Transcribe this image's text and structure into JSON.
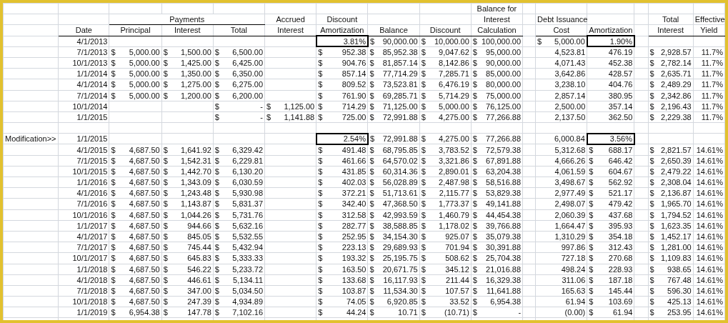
{
  "header_rows": [
    [
      null,
      null,
      null,
      null,
      null,
      null,
      null,
      null,
      null,
      "Balance for",
      null,
      null,
      null,
      null,
      null,
      null
    ],
    [
      null,
      null,
      {
        "kind": "group",
        "text": "Payments"
      },
      null,
      null,
      "Accrued",
      "Discount",
      null,
      null,
      "Interest",
      null,
      "Debt Issuance",
      null,
      null,
      "Total",
      "Effective"
    ],
    [
      null,
      "Date",
      "Principal",
      "Interest",
      "Total",
      "Interest",
      "Amortization",
      "Balance",
      "Discount",
      "Calculation",
      null,
      "Cost",
      "Amortization",
      null,
      "Interest",
      "Yield"
    ]
  ],
  "rows": [
    [
      null,
      "4/1/2013",
      null,
      null,
      null,
      null,
      {
        "kind": "boxed",
        "value": "3.81%"
      },
      [
        "$",
        "90,000.00"
      ],
      [
        "$",
        "10,000.00"
      ],
      [
        "$",
        "100,000.00"
      ],
      null,
      [
        "$",
        "5,000.00"
      ],
      {
        "kind": "boxed",
        "value": "1.90%"
      },
      null,
      null,
      null
    ],
    [
      null,
      "7/1/2013",
      [
        "$",
        "5,000.00"
      ],
      [
        "$",
        "1,500.00"
      ],
      [
        "$",
        "6,500.00"
      ],
      null,
      [
        "$",
        "952.38"
      ],
      [
        "$",
        "85,952.38"
      ],
      [
        "$",
        "9,047.62"
      ],
      [
        "$",
        "95,000.00"
      ],
      null,
      "4,523.81",
      "476.19",
      null,
      [
        "$",
        "2,928.57"
      ],
      "11.7%"
    ],
    [
      null,
      "10/1/2013",
      [
        "$",
        "5,000.00"
      ],
      [
        "$",
        "1,425.00"
      ],
      [
        "$",
        "6,425.00"
      ],
      null,
      [
        "$",
        "904.76"
      ],
      [
        "$",
        "81,857.14"
      ],
      [
        "$",
        "8,142.86"
      ],
      [
        "$",
        "90,000.00"
      ],
      null,
      "4,071.43",
      "452.38",
      null,
      [
        "$",
        "2,782.14"
      ],
      "11.7%"
    ],
    [
      null,
      "1/1/2014",
      [
        "$",
        "5,000.00"
      ],
      [
        "$",
        "1,350.00"
      ],
      [
        "$",
        "6,350.00"
      ],
      null,
      [
        "$",
        "857.14"
      ],
      [
        "$",
        "77,714.29"
      ],
      [
        "$",
        "7,285.71"
      ],
      [
        "$",
        "85,000.00"
      ],
      null,
      "3,642.86",
      "428.57",
      null,
      [
        "$",
        "2,635.71"
      ],
      "11.7%"
    ],
    [
      null,
      "4/1/2014",
      [
        "$",
        "5,000.00"
      ],
      [
        "$",
        "1,275.00"
      ],
      [
        "$",
        "6,275.00"
      ],
      null,
      [
        "$",
        "809.52"
      ],
      [
        "$",
        "73,523.81"
      ],
      [
        "$",
        "6,476.19"
      ],
      [
        "$",
        "80,000.00"
      ],
      null,
      "3,238.10",
      "404.76",
      null,
      [
        "$",
        "2,489.29"
      ],
      "11.7%"
    ],
    [
      null,
      "7/1/2014",
      [
        "$",
        "5,000.00"
      ],
      [
        "$",
        "1,200.00"
      ],
      [
        "$",
        "6,200.00"
      ],
      null,
      [
        "$",
        "761.90"
      ],
      [
        "$",
        "69,285.71"
      ],
      [
        "$",
        "5,714.29"
      ],
      [
        "$",
        "75,000.00"
      ],
      null,
      "2,857.14",
      "380.95",
      null,
      [
        "$",
        "2,342.86"
      ],
      "11.7%"
    ],
    [
      null,
      "10/1/2014",
      null,
      null,
      [
        "$",
        "-"
      ],
      [
        "$",
        "1,125.00"
      ],
      [
        "$",
        "714.29"
      ],
      [
        "$",
        "71,125.00"
      ],
      [
        "$",
        "5,000.00"
      ],
      [
        "$",
        "76,125.00"
      ],
      null,
      "2,500.00",
      "357.14",
      null,
      [
        "$",
        "2,196.43"
      ],
      "11.7%"
    ],
    [
      null,
      "1/1/2015",
      null,
      null,
      [
        "$",
        "-"
      ],
      [
        "$",
        "1,141.88"
      ],
      [
        "$",
        "725.00"
      ],
      [
        "$",
        "72,991.88"
      ],
      [
        "$",
        "4,275.00"
      ],
      [
        "$",
        "77,266.88"
      ],
      null,
      "2,137.50",
      "362.50",
      null,
      [
        "$",
        "2,229.38"
      ],
      "11.7%"
    ],
    [
      null,
      null,
      null,
      null,
      null,
      null,
      null,
      null,
      null,
      null,
      null,
      null,
      null,
      null,
      null,
      null
    ],
    [
      "Modification>>",
      "1/1/2015",
      null,
      null,
      null,
      null,
      {
        "kind": "boxed",
        "value": "2.54%"
      },
      [
        "$",
        "72,991.88"
      ],
      [
        "$",
        "4,275.00"
      ],
      [
        "$",
        "77,266.88"
      ],
      null,
      "6,000.84",
      {
        "kind": "boxed",
        "value": "3.56%"
      },
      null,
      null,
      null
    ],
    [
      null,
      "4/1/2015",
      [
        "$",
        "4,687.50"
      ],
      [
        "$",
        "1,641.92"
      ],
      [
        "$",
        "6,329.42"
      ],
      null,
      [
        "$",
        "491.48"
      ],
      [
        "$",
        "68,795.85"
      ],
      [
        "$",
        "3,783.52"
      ],
      [
        "$",
        "72,579.38"
      ],
      null,
      "5,312.68",
      [
        "$",
        "688.17"
      ],
      null,
      [
        "$",
        "2,821.57"
      ],
      "14.61%"
    ],
    [
      null,
      "7/1/2015",
      [
        "$",
        "4,687.50"
      ],
      [
        "$",
        "1,542.31"
      ],
      [
        "$",
        "6,229.81"
      ],
      null,
      [
        "$",
        "461.66"
      ],
      [
        "$",
        "64,570.02"
      ],
      [
        "$",
        "3,321.86"
      ],
      [
        "$",
        "67,891.88"
      ],
      null,
      "4,666.26",
      [
        "$",
        "646.42"
      ],
      null,
      [
        "$",
        "2,650.39"
      ],
      "14.61%"
    ],
    [
      null,
      "10/1/2015",
      [
        "$",
        "4,687.50"
      ],
      [
        "$",
        "1,442.70"
      ],
      [
        "$",
        "6,130.20"
      ],
      null,
      [
        "$",
        "431.85"
      ],
      [
        "$",
        "60,314.36"
      ],
      [
        "$",
        "2,890.01"
      ],
      [
        "$",
        "63,204.38"
      ],
      null,
      "4,061.59",
      [
        "$",
        "604.67"
      ],
      null,
      [
        "$",
        "2,479.22"
      ],
      "14.61%"
    ],
    [
      null,
      "1/1/2016",
      [
        "$",
        "4,687.50"
      ],
      [
        "$",
        "1,343.09"
      ],
      [
        "$",
        "6,030.59"
      ],
      null,
      [
        "$",
        "402.03"
      ],
      [
        "$",
        "56,028.89"
      ],
      [
        "$",
        "2,487.98"
      ],
      [
        "$",
        "58,516.88"
      ],
      null,
      "3,498.67",
      [
        "$",
        "562.92"
      ],
      null,
      [
        "$",
        "2,308.04"
      ],
      "14.61%"
    ],
    [
      null,
      "4/1/2016",
      [
        "$",
        "4,687.50"
      ],
      [
        "$",
        "1,243.48"
      ],
      [
        "$",
        "5,930.98"
      ],
      null,
      [
        "$",
        "372.21"
      ],
      [
        "$",
        "51,713.61"
      ],
      [
        "$",
        "2,115.77"
      ],
      [
        "$",
        "53,829.38"
      ],
      null,
      "2,977.49",
      [
        "$",
        "521.17"
      ],
      null,
      [
        "$",
        "2,136.87"
      ],
      "14.61%"
    ],
    [
      null,
      "7/1/2016",
      [
        "$",
        "4,687.50"
      ],
      [
        "$",
        "1,143.87"
      ],
      [
        "$",
        "5,831.37"
      ],
      null,
      [
        "$",
        "342.40"
      ],
      [
        "$",
        "47,368.50"
      ],
      [
        "$",
        "1,773.37"
      ],
      [
        "$",
        "49,141.88"
      ],
      null,
      "2,498.07",
      [
        "$",
        "479.42"
      ],
      null,
      [
        "$",
        "1,965.70"
      ],
      "14.61%"
    ],
    [
      null,
      "10/1/2016",
      [
        "$",
        "4,687.50"
      ],
      [
        "$",
        "1,044.26"
      ],
      [
        "$",
        "5,731.76"
      ],
      null,
      [
        "$",
        "312.58"
      ],
      [
        "$",
        "42,993.59"
      ],
      [
        "$",
        "1,460.79"
      ],
      [
        "$",
        "44,454.38"
      ],
      null,
      "2,060.39",
      [
        "$",
        "437.68"
      ],
      null,
      [
        "$",
        "1,794.52"
      ],
      "14.61%"
    ],
    [
      null,
      "1/1/2017",
      [
        "$",
        "4,687.50"
      ],
      [
        "$",
        "944.66"
      ],
      [
        "$",
        "5,632.16"
      ],
      null,
      [
        "$",
        "282.77"
      ],
      [
        "$",
        "38,588.85"
      ],
      [
        "$",
        "1,178.02"
      ],
      [
        "$",
        "39,766.88"
      ],
      null,
      "1,664.47",
      [
        "$",
        "395.93"
      ],
      null,
      [
        "$",
        "1,623.35"
      ],
      "14.61%"
    ],
    [
      null,
      "4/1/2017",
      [
        "$",
        "4,687.50"
      ],
      [
        "$",
        "845.05"
      ],
      [
        "$",
        "5,532.55"
      ],
      null,
      [
        "$",
        "252.95"
      ],
      [
        "$",
        "34,154.30"
      ],
      [
        "$",
        "925.07"
      ],
      [
        "$",
        "35,079.38"
      ],
      null,
      "1,310.29",
      [
        "$",
        "354.18"
      ],
      null,
      [
        "$",
        "1,452.17"
      ],
      "14.61%"
    ],
    [
      null,
      "7/1/2017",
      [
        "$",
        "4,687.50"
      ],
      [
        "$",
        "745.44"
      ],
      [
        "$",
        "5,432.94"
      ],
      null,
      [
        "$",
        "223.13"
      ],
      [
        "$",
        "29,689.93"
      ],
      [
        "$",
        "701.94"
      ],
      [
        "$",
        "30,391.88"
      ],
      null,
      "997.86",
      [
        "$",
        "312.43"
      ],
      null,
      [
        "$",
        "1,281.00"
      ],
      "14.61%"
    ],
    [
      null,
      "10/1/2017",
      [
        "$",
        "4,687.50"
      ],
      [
        "$",
        "645.83"
      ],
      [
        "$",
        "5,333.33"
      ],
      null,
      [
        "$",
        "193.32"
      ],
      [
        "$",
        "25,195.75"
      ],
      [
        "$",
        "508.62"
      ],
      [
        "$",
        "25,704.38"
      ],
      null,
      "727.18",
      [
        "$",
        "270.68"
      ],
      null,
      [
        "$",
        "1,109.83"
      ],
      "14.61%"
    ],
    [
      null,
      "1/1/2018",
      [
        "$",
        "4,687.50"
      ],
      [
        "$",
        "546.22"
      ],
      [
        "$",
        "5,233.72"
      ],
      null,
      [
        "$",
        "163.50"
      ],
      [
        "$",
        "20,671.75"
      ],
      [
        "$",
        "345.12"
      ],
      [
        "$",
        "21,016.88"
      ],
      null,
      "498.24",
      [
        "$",
        "228.93"
      ],
      null,
      [
        "$",
        "938.65"
      ],
      "14.61%"
    ],
    [
      null,
      "4/1/2018",
      [
        "$",
        "4,687.50"
      ],
      [
        "$",
        "446.61"
      ],
      [
        "$",
        "5,134.11"
      ],
      null,
      [
        "$",
        "133.68"
      ],
      [
        "$",
        "16,117.93"
      ],
      [
        "$",
        "211.44"
      ],
      [
        "$",
        "16,329.38"
      ],
      null,
      "311.06",
      [
        "$",
        "187.18"
      ],
      null,
      [
        "$",
        "767.48"
      ],
      "14.61%"
    ],
    [
      null,
      "7/1/2018",
      [
        "$",
        "4,687.50"
      ],
      [
        "$",
        "347.00"
      ],
      [
        "$",
        "5,034.50"
      ],
      null,
      [
        "$",
        "103.87"
      ],
      [
        "$",
        "11,534.30"
      ],
      [
        "$",
        "107.57"
      ],
      [
        "$",
        "11,641.88"
      ],
      null,
      "165.63",
      [
        "$",
        "145.44"
      ],
      null,
      [
        "$",
        "596.30"
      ],
      "14.61%"
    ],
    [
      null,
      "10/1/2018",
      [
        "$",
        "4,687.50"
      ],
      [
        "$",
        "247.39"
      ],
      [
        "$",
        "4,934.89"
      ],
      null,
      [
        "$",
        "74.05"
      ],
      [
        "$",
        "6,920.85"
      ],
      [
        "$",
        "33.52"
      ],
      [
        "$",
        "6,954.38"
      ],
      null,
      "61.94",
      [
        "$",
        "103.69"
      ],
      null,
      [
        "$",
        "425.13"
      ],
      "14.61%"
    ],
    [
      null,
      "1/1/2019",
      [
        "$",
        "6,954.38"
      ],
      [
        "$",
        "147.78"
      ],
      [
        "$",
        "7,102.16"
      ],
      null,
      [
        "$",
        "44.24"
      ],
      [
        "$",
        "10.71"
      ],
      [
        "$",
        "(10.71)"
      ],
      [
        "$",
        "-"
      ],
      null,
      "(0.00)",
      [
        "$",
        "61.94"
      ],
      null,
      [
        "$",
        "253.95"
      ],
      "14.61%"
    ]
  ]
}
